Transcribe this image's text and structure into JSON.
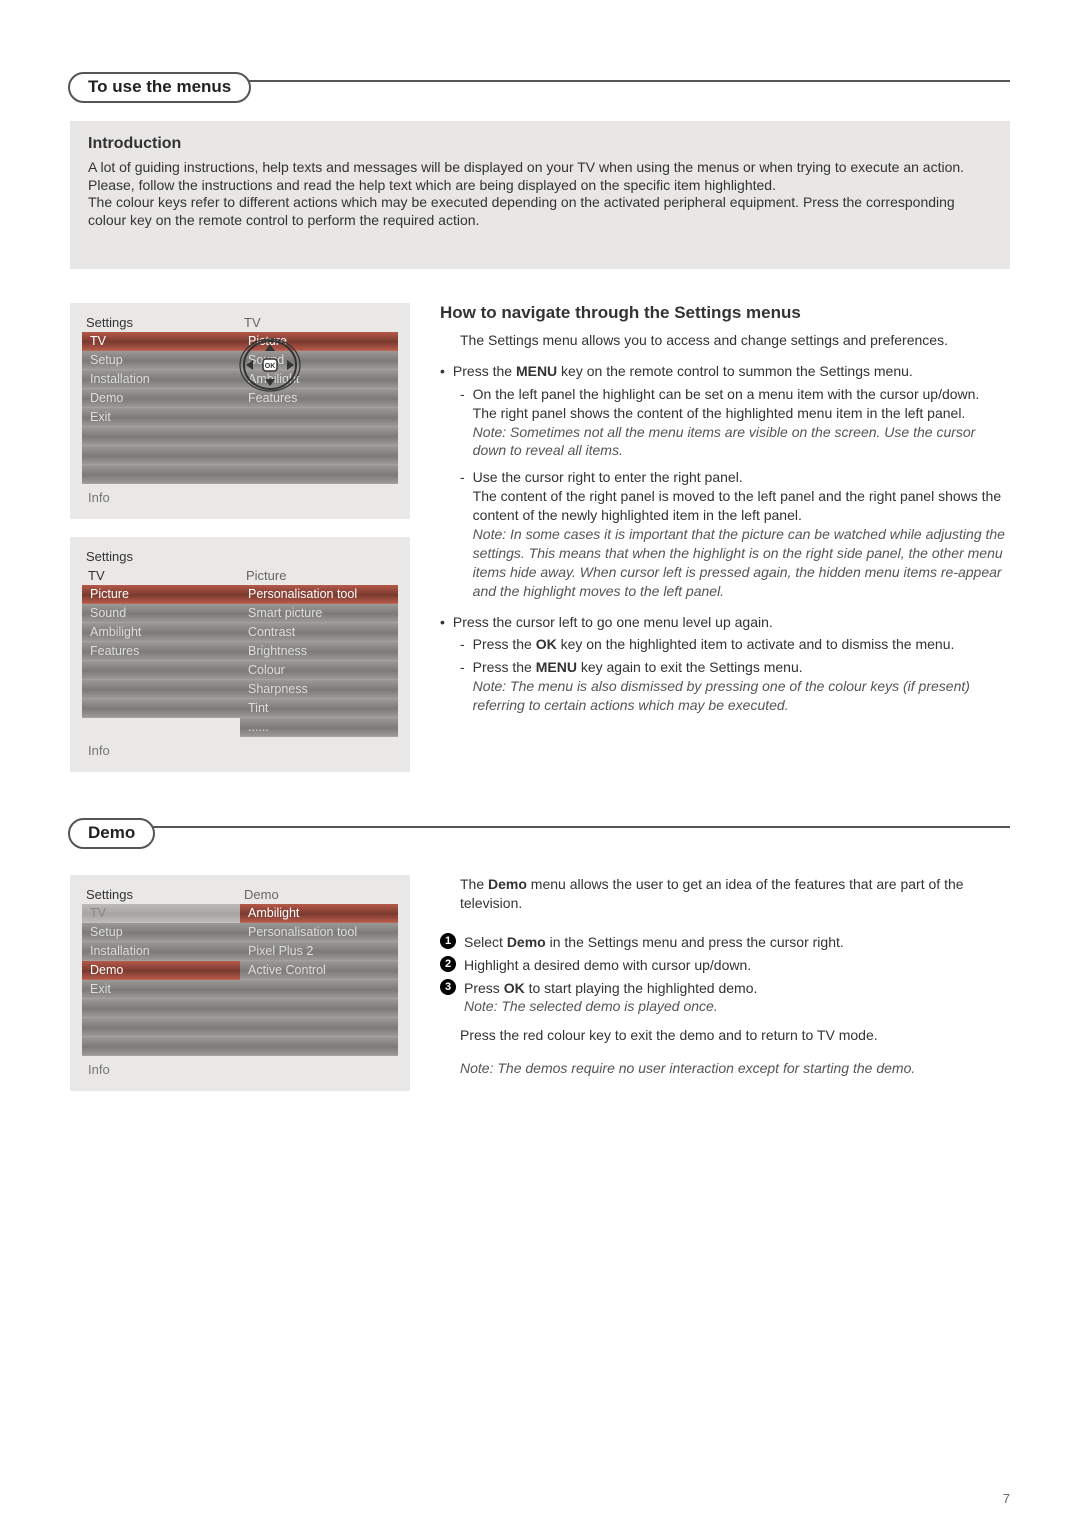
{
  "section1": {
    "title": "To use the menus",
    "intro_heading": "Introduction",
    "intro_p1": "A lot of guiding instructions, help texts and messages will be displayed on your TV when using the menus or when trying to execute an action.",
    "intro_p2": "Please, follow the instructions and read the help text which are being displayed on the specific item highlighted.",
    "intro_p3": "The colour keys refer to different actions which may be executed depending on the activated peripheral equipment. Press the corresponding colour key on the remote control to perform the required action."
  },
  "panel1": {
    "left_title": "Settings",
    "right_title": "TV",
    "left_items": [
      "TV",
      "Setup",
      "Installation",
      "Demo",
      "Exit",
      "",
      "",
      ""
    ],
    "right_items": [
      "Picture",
      "Sound",
      "Ambilight",
      "Features",
      "",
      "",
      "",
      ""
    ],
    "info": "Info"
  },
  "panel2": {
    "left_title": "Settings",
    "left_sub": "TV",
    "right_title": "Picture",
    "left_items": [
      "Picture",
      "Sound",
      "Ambilight",
      "Features",
      "",
      "",
      "",
      ""
    ],
    "right_items": [
      "Personalisation tool",
      "Smart picture",
      "Contrast",
      "Brightness",
      "Colour",
      "Sharpness",
      "Tint",
      "......"
    ],
    "info": "Info"
  },
  "howto": {
    "heading": "How to navigate through the Settings menus",
    "p1": "The Settings menu allows you to access and change settings and preferences.",
    "b1_pre": "Press the ",
    "b1_bold": "MENU",
    "b1_post": " key on the remote control to summon the Settings menu.",
    "b1_sub1": "On the left panel the highlight can be set on a menu item with the cursor up/down.",
    "b1_sub1b": "The right panel shows the content of the highlighted menu item in the left panel.",
    "b1_note": "Note: Sometimes not all the menu items are visible on the screen. Use the cursor down to reveal all items.",
    "b1_sub2": "Use the cursor right to enter the right panel.",
    "b1_sub2b": "The content of the right panel is moved to the left panel and the right panel shows the content of the newly highlighted item in the left panel.",
    "b1_note2": "Note: In some cases it is important that the picture can be watched while adjusting the settings. This means that when the highlight is on the right side panel, the other menu items hide away. When cursor left is pressed again, the hidden menu items re-appear and the highlight moves to the left panel.",
    "b2": "Press the cursor left to go one menu level up again.",
    "b2_sub1_pre": "Press the ",
    "b2_sub1_bold": "OK",
    "b2_sub1_post": " key on the highlighted item to activate and to dismiss the menu.",
    "b2_sub2_pre": "Press the ",
    "b2_sub2_bold": "MENU",
    "b2_sub2_post": " key again to exit the Settings menu.",
    "b2_note": "Note: The menu is also dismissed by pressing one of the colour keys (if present) referring to certain actions which may be executed."
  },
  "section2": {
    "title": "Demo"
  },
  "panel3": {
    "left_title": "Settings",
    "right_title": "Demo",
    "left_items": [
      "TV",
      "Setup",
      "Installation",
      "Demo",
      "Exit",
      "",
      "",
      ""
    ],
    "right_items": [
      "Ambilight",
      "Personalisation tool",
      "Pixel Plus 2",
      "Active Control",
      "",
      "",
      "",
      ""
    ],
    "info": "Info"
  },
  "demo": {
    "p1_pre": "The ",
    "p1_bold": "Demo",
    "p1_post": " menu allows the user to get an idea of the features that are part of the television.",
    "s1_pre": "Select ",
    "s1_bold": "Demo",
    "s1_post": " in the Settings menu and press the cursor right.",
    "s2": "Highlight a desired demo with cursor up/down.",
    "s3_pre": "Press ",
    "s3_bold": "OK",
    "s3_post": " to start playing the highlighted demo.",
    "s3_note": "Note: The selected demo is played once.",
    "p2": "Press the red colour key to exit the demo and to return to TV mode.",
    "note2": "Note: The demos require no user interaction except for starting the demo."
  },
  "page_number": "7"
}
